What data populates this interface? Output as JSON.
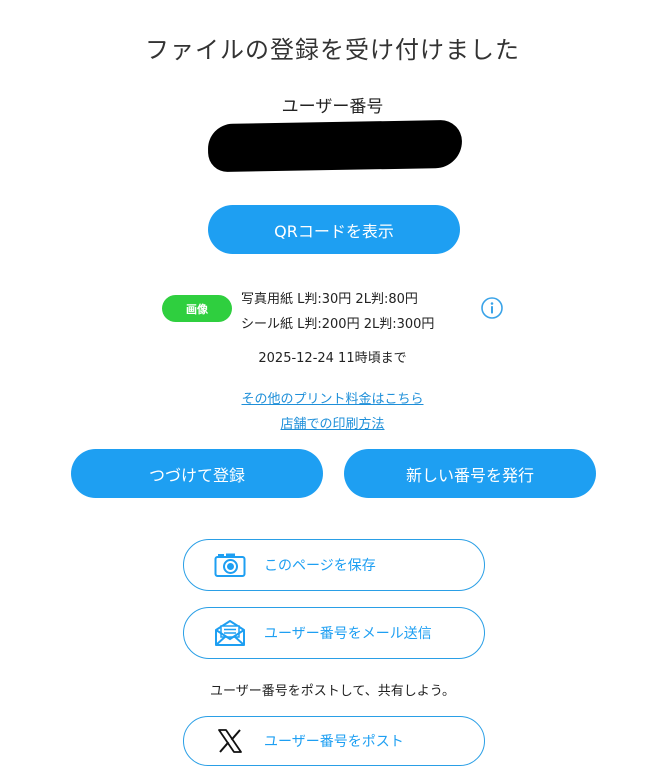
{
  "title": "ファイルの登録を受け付けました",
  "user_number_label": "ユーザー番号",
  "qr_button": "QRコードを表示",
  "badge": "画像",
  "prices": {
    "photo": "写真用紙 L判:30円 2L判:80円",
    "sticker": "シール紙 L判:200円 2L判:300円"
  },
  "deadline": "2025-12-24 11時頃まで",
  "links": {
    "other_prices": "その他のプリント料金はこちら",
    "how_to_print": "店舗での印刷方法"
  },
  "buttons": {
    "continue": "つづけて登録",
    "new_number": "新しい番号を発行",
    "save_page": "このページを保存",
    "send_mail": "ユーザー番号をメール送信",
    "post": "ユーザー番号をポスト"
  },
  "share_text": "ユーザー番号をポストして、共有しよう。",
  "icons": {
    "info": "info-icon",
    "camera": "camera-icon",
    "mail": "mail-icon",
    "x": "x-logo-icon"
  },
  "colors": {
    "primary": "#1e9ff2",
    "badge": "#2fcf3f",
    "link": "#1e8fd9"
  }
}
